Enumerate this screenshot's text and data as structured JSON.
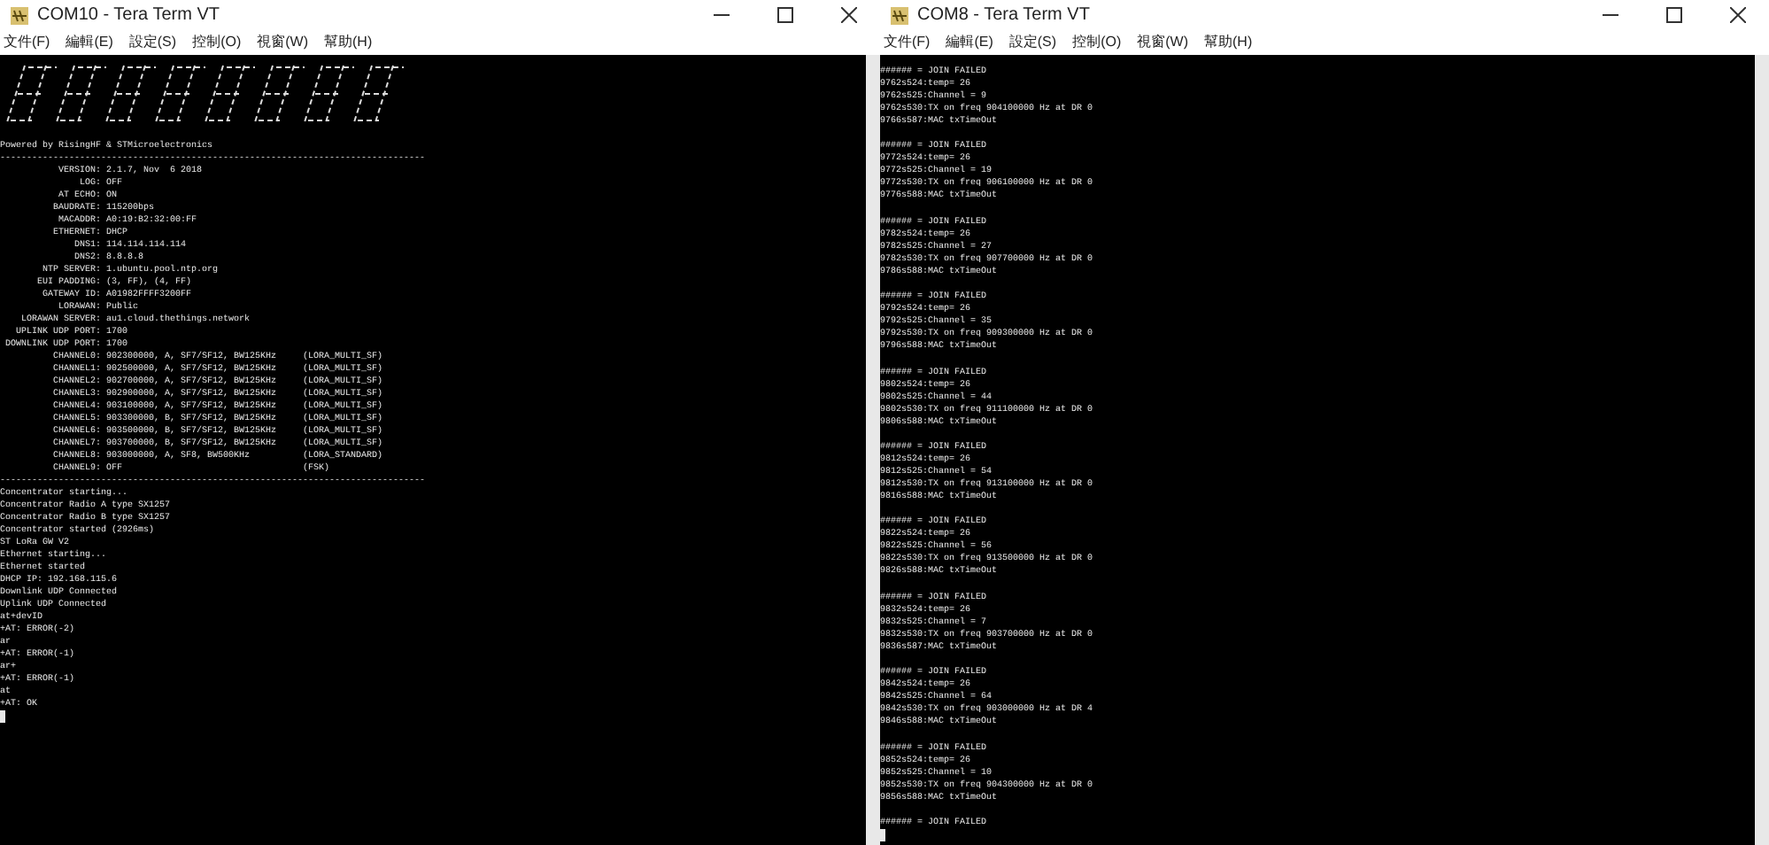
{
  "windows": [
    {
      "title": "COM10 - Tera Term VT",
      "menu": [
        "文件(F)",
        "編輯(E)",
        "設定(S)",
        "控制(O)",
        "視窗(W)",
        "幫助(H)"
      ],
      "kind": "console",
      "lines": [
        "Powered by RisingHF & STMicroelectronics",
        "--------------------------------------------------------------------------------",
        "           VERSION: 2.1.7, Nov  6 2018",
        "               LOG: OFF",
        "           AT ECHO: ON",
        "          BAUDRATE: 115200bps",
        "           MACADDR: A0:19:B2:32:00:FF",
        "          ETHERNET: DHCP",
        "              DNS1: 114.114.114.114",
        "              DNS2: 8.8.8.8",
        "        NTP SERVER: 1.ubuntu.pool.ntp.org",
        "       EUI PADDING: (3, FF), (4, FF)",
        "        GATEWAY ID: A01982FFFF3200FF",
        "           LORAWAN: Public",
        "    LORAWAN SERVER: au1.cloud.thethings.network",
        "   UPLINK UDP PORT: 1700",
        " DOWNLINK UDP PORT: 1700",
        "          CHANNEL0: 902300000, A, SF7/SF12, BW125KHz     (LORA_MULTI_SF)",
        "          CHANNEL1: 902500000, A, SF7/SF12, BW125KHz     (LORA_MULTI_SF)",
        "          CHANNEL2: 902700000, A, SF7/SF12, BW125KHz     (LORA_MULTI_SF)",
        "          CHANNEL3: 902900000, A, SF7/SF12, BW125KHz     (LORA_MULTI_SF)",
        "          CHANNEL4: 903100000, A, SF7/SF12, BW125KHz     (LORA_MULTI_SF)",
        "          CHANNEL5: 903300000, B, SF7/SF12, BW125KHz     (LORA_MULTI_SF)",
        "          CHANNEL6: 903500000, B, SF7/SF12, BW125KHz     (LORA_MULTI_SF)",
        "          CHANNEL7: 903700000, B, SF7/SF12, BW125KHz     (LORA_MULTI_SF)",
        "          CHANNEL8: 903000000, A, SF8, BW500KHz          (LORA_STANDARD)",
        "          CHANNEL9: OFF                                  (FSK)",
        "--------------------------------------------------------------------------------",
        "Concentrator starting...",
        "Concentrator Radio A type SX1257",
        "Concentrator Radio B type SX1257",
        "Concentrator started (2926ms)",
        "ST LoRa GW V2",
        "Ethernet starting...",
        "Ethernet started",
        "DHCP IP: 192.168.115.6",
        "Downlink UDP Connected",
        "Uplink UDP Connected",
        "at+devID",
        "+AT: ERROR(-2)",
        "ar",
        "+AT: ERROR(-1)",
        "ar+",
        "+AT: ERROR(-1)",
        "at",
        "+AT: OK"
      ]
    },
    {
      "title": "COM8 - Tera Term VT",
      "menu": [
        "文件(F)",
        "編輯(E)",
        "設定(S)",
        "控制(O)",
        "視窗(W)",
        "幫助(H)"
      ],
      "kind": "log",
      "groups": [
        {
          "lines": [
            "###### = JOIN FAILED",
            "9762s524:temp= 26",
            "9762s525:Channel = 9",
            "9762s530:TX on freq 904100000 Hz at DR 0",
            "9766s587:MAC txTimeOut"
          ]
        },
        {
          "lines": [
            "###### = JOIN FAILED",
            "9772s524:temp= 26",
            "9772s525:Channel = 19",
            "9772s530:TX on freq 906100000 Hz at DR 0",
            "9776s588:MAC txTimeOut"
          ]
        },
        {
          "lines": [
            "###### = JOIN FAILED",
            "9782s524:temp= 26",
            "9782s525:Channel = 27",
            "9782s530:TX on freq 907700000 Hz at DR 0",
            "9786s588:MAC txTimeOut"
          ]
        },
        {
          "lines": [
            "###### = JOIN FAILED",
            "9792s524:temp= 26",
            "9792s525:Channel = 35",
            "9792s530:TX on freq 909300000 Hz at DR 0",
            "9796s588:MAC txTimeOut"
          ]
        },
        {
          "lines": [
            "###### = JOIN FAILED",
            "9802s524:temp= 26",
            "9802s525:Channel = 44",
            "9802s530:TX on freq 911100000 Hz at DR 0",
            "9806s588:MAC txTimeOut"
          ]
        },
        {
          "lines": [
            "###### = JOIN FAILED",
            "9812s524:temp= 26",
            "9812s525:Channel = 54",
            "9812s530:TX on freq 913100000 Hz at DR 0",
            "9816s588:MAC txTimeOut"
          ]
        },
        {
          "lines": [
            "###### = JOIN FAILED",
            "9822s524:temp= 26",
            "9822s525:Channel = 56",
            "9822s530:TX on freq 913500000 Hz at DR 0",
            "9826s588:MAC txTimeOut"
          ]
        },
        {
          "lines": [
            "###### = JOIN FAILED",
            "9832s524:temp= 26",
            "9832s525:Channel = 7",
            "9832s530:TX on freq 903700000 Hz at DR 0",
            "9836s587:MAC txTimeOut"
          ]
        },
        {
          "lines": [
            "###### = JOIN FAILED",
            "9842s524:temp= 26",
            "9842s525:Channel = 64",
            "9842s530:TX on freq 903000000 Hz at DR 4",
            "9846s588:MAC txTimeOut"
          ]
        },
        {
          "lines": [
            "###### = JOIN FAILED",
            "9852s524:temp= 26",
            "9852s525:Channel = 10",
            "9852s530:TX on freq 904300000 Hz at DR 0",
            "9856s588:MAC txTimeOut"
          ]
        },
        {
          "lines": [
            "###### = JOIN FAILED"
          ]
        }
      ]
    }
  ]
}
